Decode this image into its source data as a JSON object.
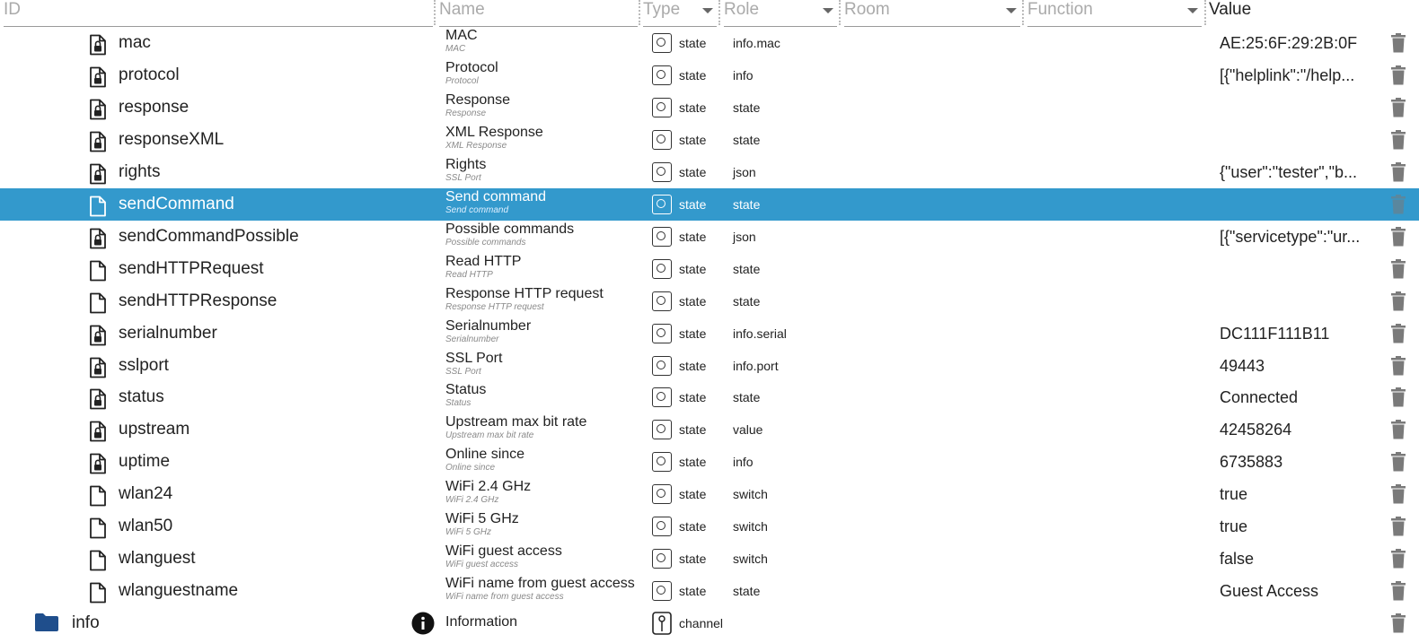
{
  "header": {
    "id": "ID",
    "name": "Name",
    "type": "Type",
    "role": "Role",
    "room": "Room",
    "function": "Function",
    "value": "Value"
  },
  "rows": [
    {
      "id": "mac",
      "icon": "lock-file-icon",
      "name": "MAC",
      "sub": "MAC",
      "type": "state",
      "role": "info.mac",
      "value": "AE:25:6F:29:2B:0F"
    },
    {
      "id": "protocol",
      "icon": "lock-file-icon",
      "name": "Protocol",
      "sub": "Protocol",
      "type": "state",
      "role": "info",
      "value": "[{\"helplink\":\"/help..."
    },
    {
      "id": "response",
      "icon": "lock-file-icon",
      "name": "Response",
      "sub": "Response",
      "type": "state",
      "role": "state",
      "value": ""
    },
    {
      "id": "responseXML",
      "icon": "lock-file-icon",
      "name": "XML Response",
      "sub": "XML Response",
      "type": "state",
      "role": "state",
      "value": ""
    },
    {
      "id": "rights",
      "icon": "lock-file-icon",
      "name": "Rights",
      "sub": "SSL Port",
      "type": "state",
      "role": "json",
      "value": "{\"user\":\"tester\",\"b..."
    },
    {
      "id": "sendCommand",
      "icon": "file-icon",
      "name": "Send command",
      "sub": "Send command",
      "type": "state",
      "role": "state",
      "value": "",
      "selected": true
    },
    {
      "id": "sendCommandPossible",
      "icon": "lock-file-icon",
      "name": "Possible commands",
      "sub": "Possible commands",
      "type": "state",
      "role": "json",
      "value": "[{\"servicetype\":\"ur..."
    },
    {
      "id": "sendHTTPRequest",
      "icon": "file-icon",
      "name": "Read HTTP",
      "sub": "Read HTTP",
      "type": "state",
      "role": "state",
      "value": ""
    },
    {
      "id": "sendHTTPResponse",
      "icon": "file-icon",
      "name": "Response HTTP request",
      "sub": "Response HTTP request",
      "type": "state",
      "role": "state",
      "value": ""
    },
    {
      "id": "serialnumber",
      "icon": "lock-file-icon",
      "name": "Serialnumber",
      "sub": "Serialnumber",
      "type": "state",
      "role": "info.serial",
      "value": "DC111F111B11"
    },
    {
      "id": "sslport",
      "icon": "lock-file-icon",
      "name": "SSL Port",
      "sub": "SSL Port",
      "type": "state",
      "role": "info.port",
      "value": "49443"
    },
    {
      "id": "status",
      "icon": "lock-file-icon",
      "name": "Status",
      "sub": "Status",
      "type": "state",
      "role": "state",
      "value": "Connected"
    },
    {
      "id": "upstream",
      "icon": "lock-file-icon",
      "name": "Upstream max bit rate",
      "sub": "Upstream max bit rate",
      "type": "state",
      "role": "value",
      "value": "42458264"
    },
    {
      "id": "uptime",
      "icon": "lock-file-icon",
      "name": "Online since",
      "sub": "Online since",
      "type": "state",
      "role": "info",
      "value": "6735883"
    },
    {
      "id": "wlan24",
      "icon": "file-icon",
      "name": "WiFi 2.4 GHz",
      "sub": "WiFi 2.4 GHz",
      "type": "state",
      "role": "switch",
      "value": "true"
    },
    {
      "id": "wlan50",
      "icon": "file-icon",
      "name": "WiFi 5 GHz",
      "sub": "WiFi 5 GHz",
      "type": "state",
      "role": "switch",
      "value": "true"
    },
    {
      "id": "wlanguest",
      "icon": "file-icon",
      "name": "WiFi guest access",
      "sub": "WiFi guest access",
      "type": "state",
      "role": "switch",
      "value": "false"
    },
    {
      "id": "wlanguestname",
      "icon": "file-icon",
      "name": "WiFi name from guest access",
      "sub": "WiFi name from guest access",
      "type": "state",
      "role": "state",
      "value": "Guest Access"
    },
    {
      "id": "info",
      "icon": "folder-icon",
      "name": "Information",
      "sub": "",
      "type": "channel",
      "role": "",
      "value": "",
      "nameIcon": "info-circle-icon"
    }
  ],
  "colors": {
    "selected": "#3399cc",
    "folder": "#1f4e8c"
  }
}
